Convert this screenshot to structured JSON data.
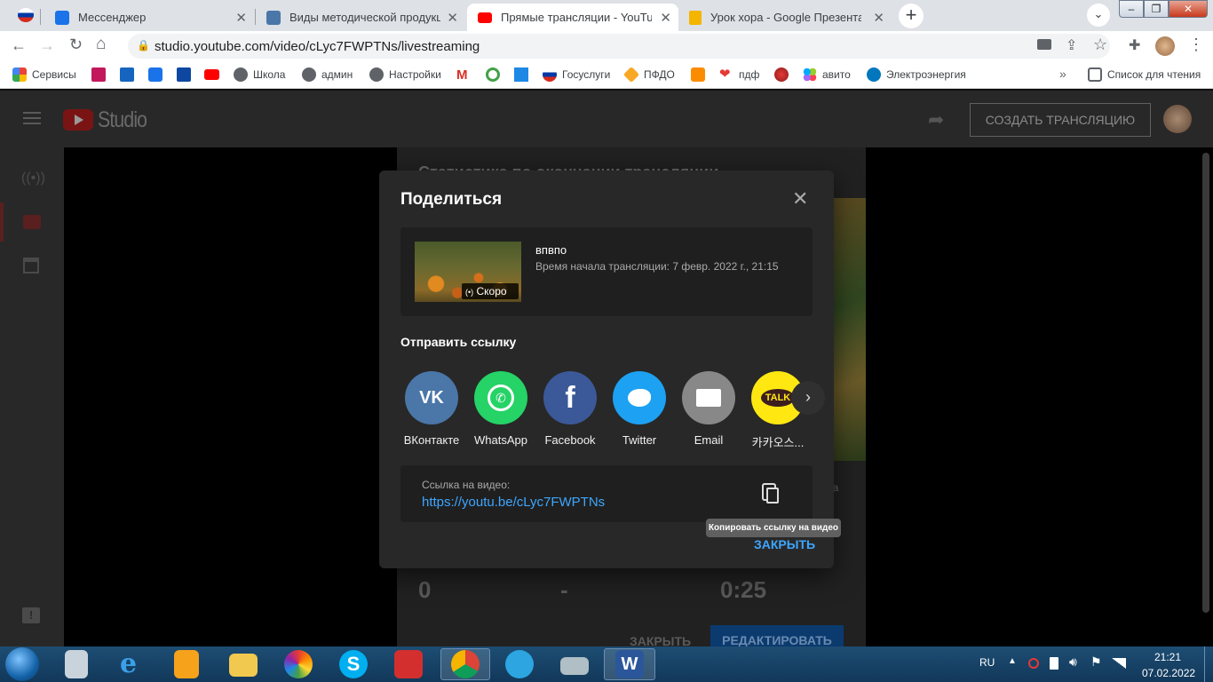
{
  "browser": {
    "tabs": [
      {
        "title": "Мессенджер",
        "icon": "messenger-icon"
      },
      {
        "title": "Виды методической продукции",
        "icon": "vk-icon"
      },
      {
        "title": "Прямые трансляции - YouTube S",
        "icon": "youtube-icon",
        "active": true
      },
      {
        "title": "Урок хора - Google Презентаци",
        "icon": "slides-icon"
      }
    ],
    "url": "studio.youtube.com/video/cLyc7FWPTNs/livestreaming",
    "bookmarks": [
      "Сервисы",
      "Школа",
      "админ",
      "Настройки",
      "Госуслуги",
      "ПФДО",
      "пдф",
      "авито",
      "Электроэнергия"
    ],
    "reading_list": "Список для чтения",
    "more_bookmarks": "»"
  },
  "studio": {
    "logo_text": "Studio",
    "create_button": "СОЗДАТЬ ТРАНСЛЯЦИЮ",
    "bg_heading": "Статистика по окончании трансляции",
    "bg_suffix": "ра",
    "stats": [
      "0",
      "-",
      "0:25"
    ],
    "close_button": "ЗАКРЫТЬ",
    "edit_button": "РЕДАКТИРОВАТЬ"
  },
  "dialog": {
    "title": "Поделиться",
    "video_title": "впвпо",
    "video_meta": "Время начала трансляции: 7 февр. 2022 г., 21:15",
    "badge": "Скоро",
    "send_link_label": "Отправить ссылку",
    "share_targets": [
      {
        "label": "ВКонтакте",
        "color": "#4a76a8",
        "icon": "vk-icon"
      },
      {
        "label": "WhatsApp",
        "color": "#25d366",
        "icon": "whatsapp-icon"
      },
      {
        "label": "Facebook",
        "color": "#3b5998",
        "icon": "facebook-icon"
      },
      {
        "label": "Twitter",
        "color": "#1da1f2",
        "icon": "twitter-icon"
      },
      {
        "label": "Email",
        "color": "#888888",
        "icon": "email-icon"
      },
      {
        "label": "카카오스...",
        "color": "#ffe812",
        "icon": "kakaotalk-icon"
      }
    ],
    "link_label": "Ссылка на видео:",
    "link": "https://youtu.be/cLyc7FWPTNs",
    "copy_tooltip": "Копировать ссылку на видео",
    "close_label": "ЗАКРЫТЬ"
  },
  "taskbar": {
    "lang": "RU",
    "time": "21:21",
    "date": "07.02.2022"
  }
}
